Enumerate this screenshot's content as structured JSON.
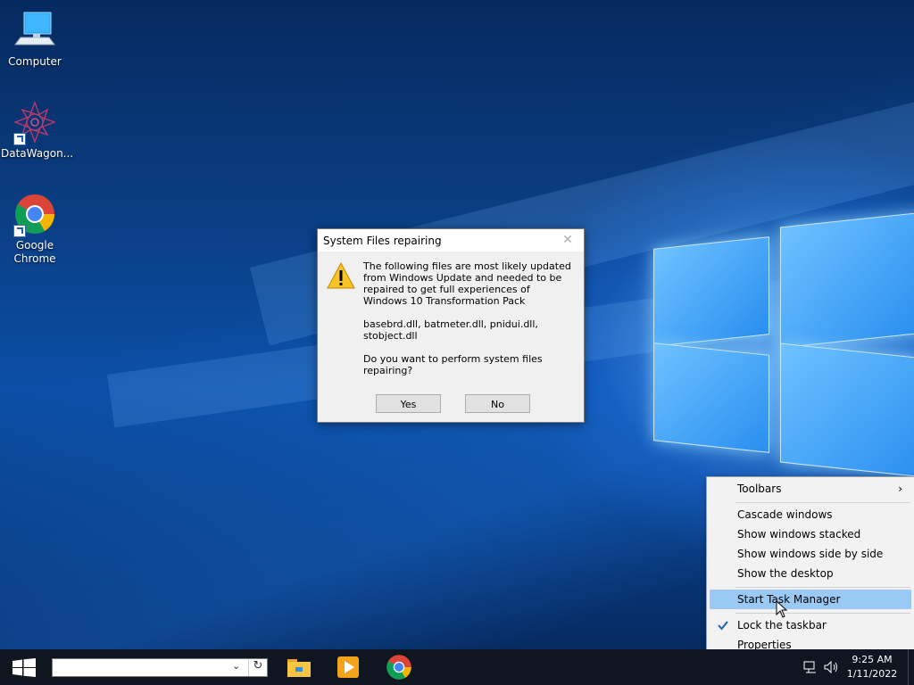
{
  "desktop": {
    "icons": [
      {
        "label": "Computer"
      },
      {
        "label": "DataWagon..."
      },
      {
        "label": "Google\nChrome"
      }
    ]
  },
  "dialog": {
    "title": "System Files repairing",
    "message_1": "The following files are most likely updated from Windows Update and needed to be repaired to get full experiences of Windows 10 Transformation Pack",
    "message_2": "basebrd.dll, batmeter.dll, pnidui.dll, stobject.dll",
    "message_3": "Do you want to perform system files repairing?",
    "yes_label": "Yes",
    "no_label": "No"
  },
  "context_menu": {
    "items": [
      {
        "label": "Toolbars",
        "submenu": true
      },
      {
        "label": "Cascade windows"
      },
      {
        "label": "Show windows stacked"
      },
      {
        "label": "Show windows side by side"
      },
      {
        "label": "Show the desktop"
      },
      {
        "label": "Start Task Manager",
        "highlighted": true
      },
      {
        "label": "Lock the taskbar",
        "checked": true
      },
      {
        "label": "Properties"
      }
    ]
  },
  "taskbar": {
    "search": {
      "value": "",
      "placeholder": ""
    },
    "clock": {
      "time": "9:25 AM",
      "date": "1/11/2022"
    }
  },
  "colors": {
    "menu_highlight": "#9ac9f3",
    "taskbar_bg": "#101620",
    "dialog_bg": "#f0f0f0"
  }
}
